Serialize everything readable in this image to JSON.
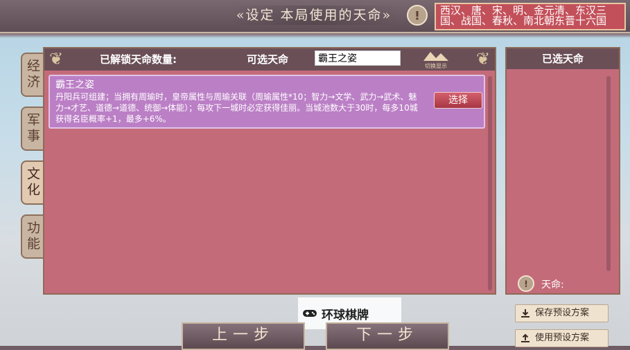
{
  "header": {
    "title": "«设定 本局使用的天命»",
    "dynasties": "西汉、唐、宋、明、金元清、东汉三国、战国、春秋、南北朝东晋十六国"
  },
  "sidebar": {
    "tabs": [
      {
        "label": "经济"
      },
      {
        "label": "军事"
      },
      {
        "label": "文化"
      },
      {
        "label": "功能"
      }
    ]
  },
  "main": {
    "unlocked_label": "已解锁天命数量:",
    "available_label": "可选天命",
    "search_value": "霸王之姿",
    "logo_text": "切换显示",
    "card": {
      "title": "霸王之姿",
      "description": "丹阳兵可组建；当拥有周瑜时，皇帝属性与周瑜关联（周瑜属性*10；智力→文学、武力→武术、魅力→才艺、道德→道德、统御→体能）；每攻下一城时必定获得佳丽。当城池数大于30时，每多10城获得名臣概率+1，最多+6%。",
      "select_label": "选择"
    }
  },
  "right": {
    "title": "已选天命",
    "fate_label": "天命:"
  },
  "watermark": {
    "text": "环球棋牌"
  },
  "footer": {
    "prev_label": "上一步",
    "next_label": "下一步",
    "save_preset": "保存预设方案",
    "use_preset": "使用预设方案"
  },
  "colors": {
    "panel": "#c46b7a",
    "card": "#bb7fc6",
    "header": "#6a4f57"
  }
}
